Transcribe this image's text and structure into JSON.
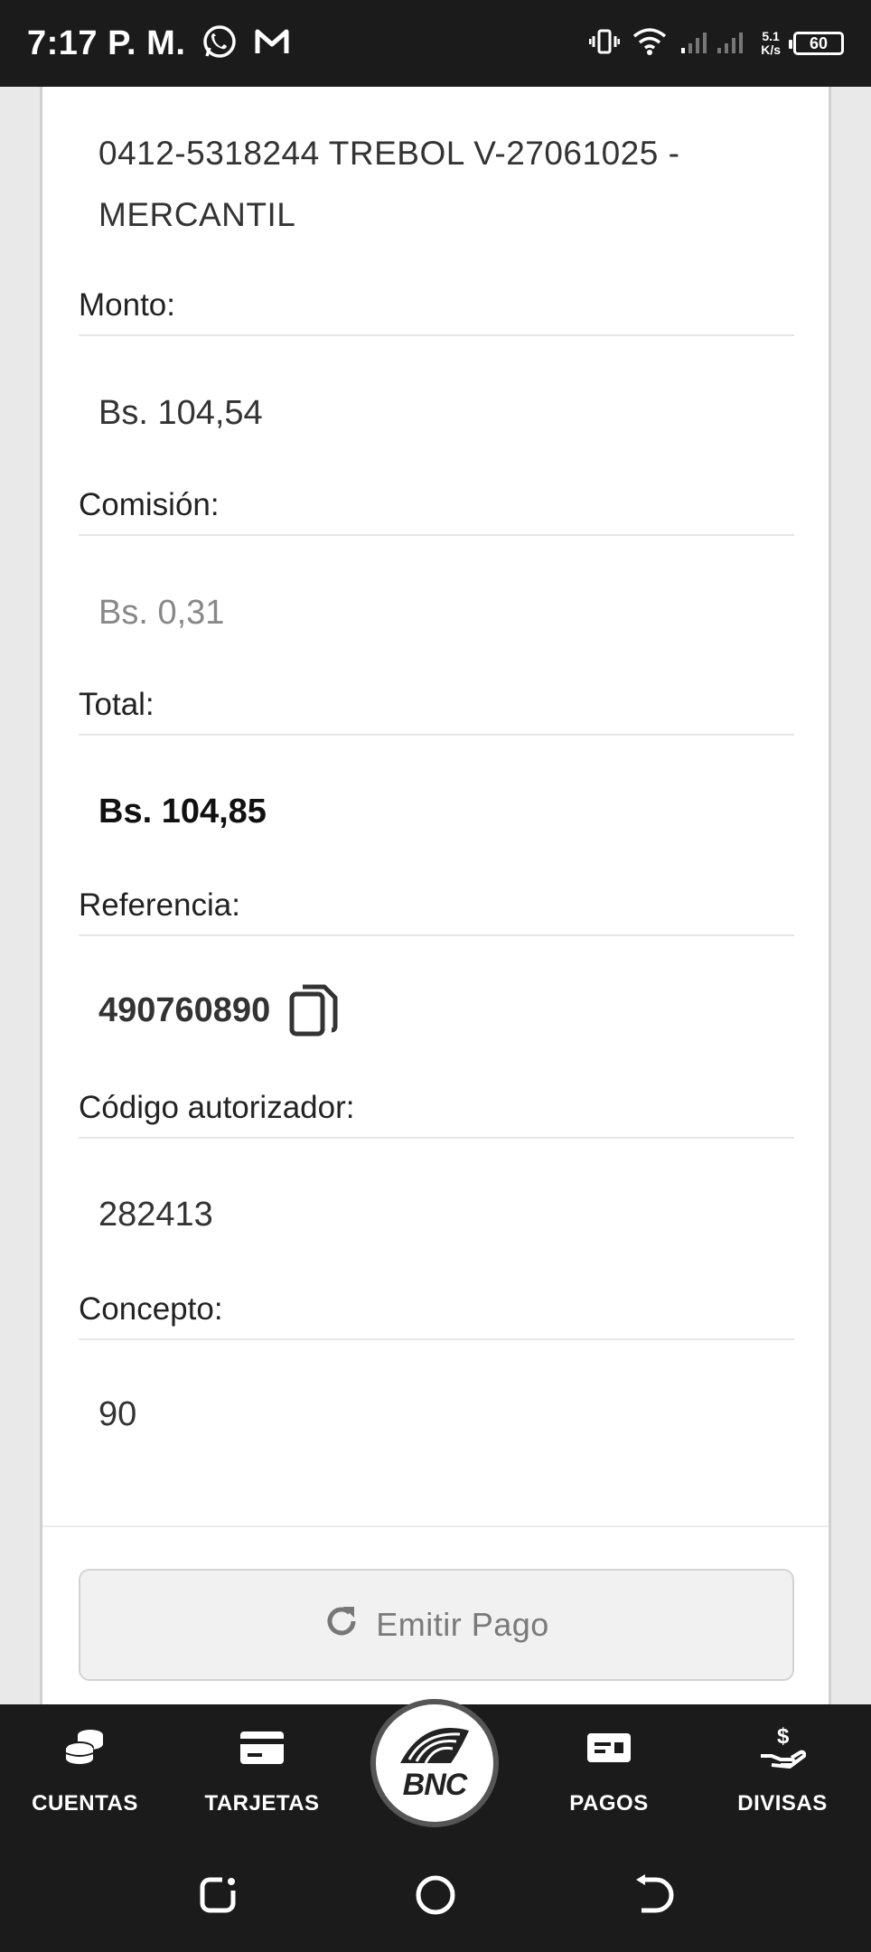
{
  "status_bar": {
    "time": "7:17 P. M.",
    "speed_value": "5.1",
    "speed_unit": "K/s",
    "battery": "60"
  },
  "detail": {
    "destination": "0412-5318244 TREBOL V-27061025 - MERCANTIL",
    "fields": [
      {
        "label": "Monto:",
        "value": "Bs. 104,54"
      },
      {
        "label": "Comisión:",
        "value": "Bs. 0,31"
      },
      {
        "label": "Total:",
        "value": "Bs. 104,85"
      },
      {
        "label": "Referencia:",
        "value": "490760890"
      },
      {
        "label": "Código autorizador:",
        "value": "282413"
      },
      {
        "label": "Concepto:",
        "value": "90"
      }
    ]
  },
  "actions": {
    "emit_payment_label": "Emitir Pago"
  },
  "bottom_nav": {
    "items": [
      {
        "label": "CUENTAS",
        "icon": "coins-icon"
      },
      {
        "label": "TARJETAS",
        "icon": "card-icon"
      },
      {
        "label": "",
        "icon": "bnc-logo"
      },
      {
        "label": "PAGOS",
        "icon": "payments-icon"
      },
      {
        "label": "DIVISAS",
        "icon": "currency-hand-icon"
      }
    ],
    "logo_text": "BNC"
  },
  "colors": {
    "bar_background": "#1b1b1b",
    "card_background": "#ffffff",
    "muted_text": "#888888"
  }
}
